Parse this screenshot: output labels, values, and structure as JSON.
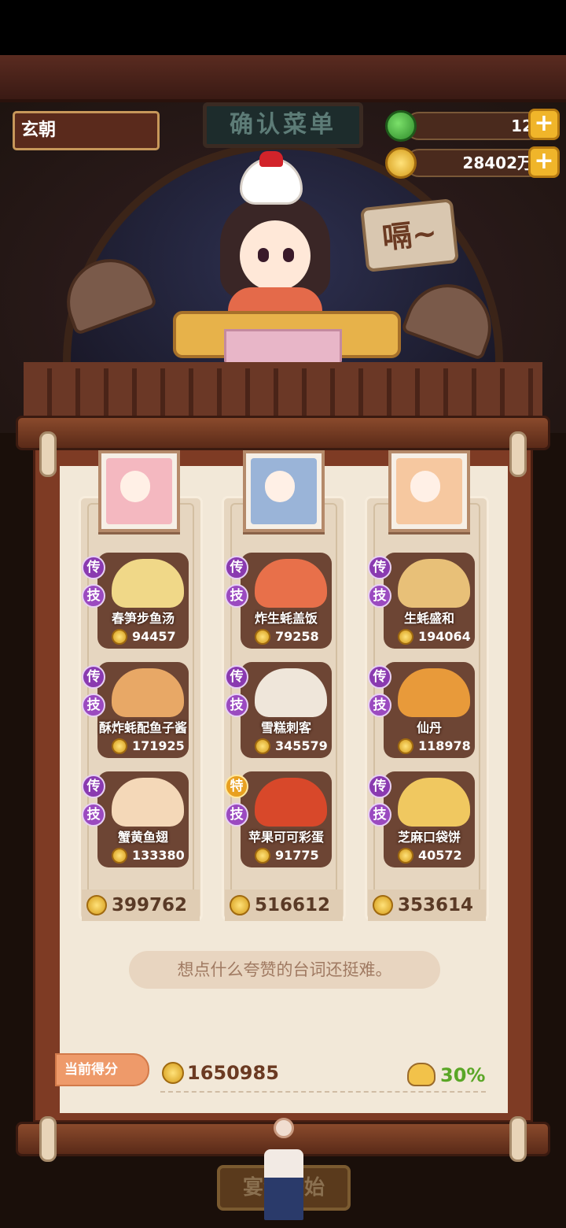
{
  "header": {
    "player_name": "玄朝",
    "sign_title": "确认菜单",
    "jade_count": "12",
    "coin_count": "28402万",
    "plus_label": "+",
    "speech": "嗝~"
  },
  "columns": [
    {
      "total": "399762",
      "dishes": [
        {
          "rank": "传",
          "skill": "技",
          "name": "春笋步鱼汤",
          "value": "94457"
        },
        {
          "rank": "传",
          "skill": "技",
          "name": "酥炸蚝配鱼子酱",
          "value": "171925"
        },
        {
          "rank": "传",
          "skill": "技",
          "name": "蟹黄鱼翅",
          "value": "133380"
        }
      ]
    },
    {
      "total": "516612",
      "dishes": [
        {
          "rank": "传",
          "skill": "技",
          "name": "炸生蚝盖饭",
          "value": "79258"
        },
        {
          "rank": "传",
          "skill": "技",
          "name": "雪糕刺客",
          "value": "345579"
        },
        {
          "rank": "特",
          "skill": "技",
          "name": "苹果可可彩蛋",
          "value": "91775"
        }
      ]
    },
    {
      "total": "353614",
      "dishes": [
        {
          "rank": "传",
          "skill": "技",
          "name": "生蚝盛和",
          "value": "194064"
        },
        {
          "rank": "传",
          "skill": "技",
          "name": "仙丹",
          "value": "118978"
        },
        {
          "rank": "传",
          "skill": "技",
          "name": "芝麻口袋饼",
          "value": "40572"
        }
      ]
    }
  ],
  "footer": {
    "quote": "想点什么夸赞的台词还挺难。",
    "score_label": "当前得分",
    "score_value": "1650985",
    "bonus": "30%",
    "start_label": "宴会开始"
  },
  "colors": {
    "accent_gold": "#f0b52a",
    "scroll_wood": "#7e3b24",
    "paper": "#f2e8d8",
    "bonus_green": "#5aa626"
  }
}
